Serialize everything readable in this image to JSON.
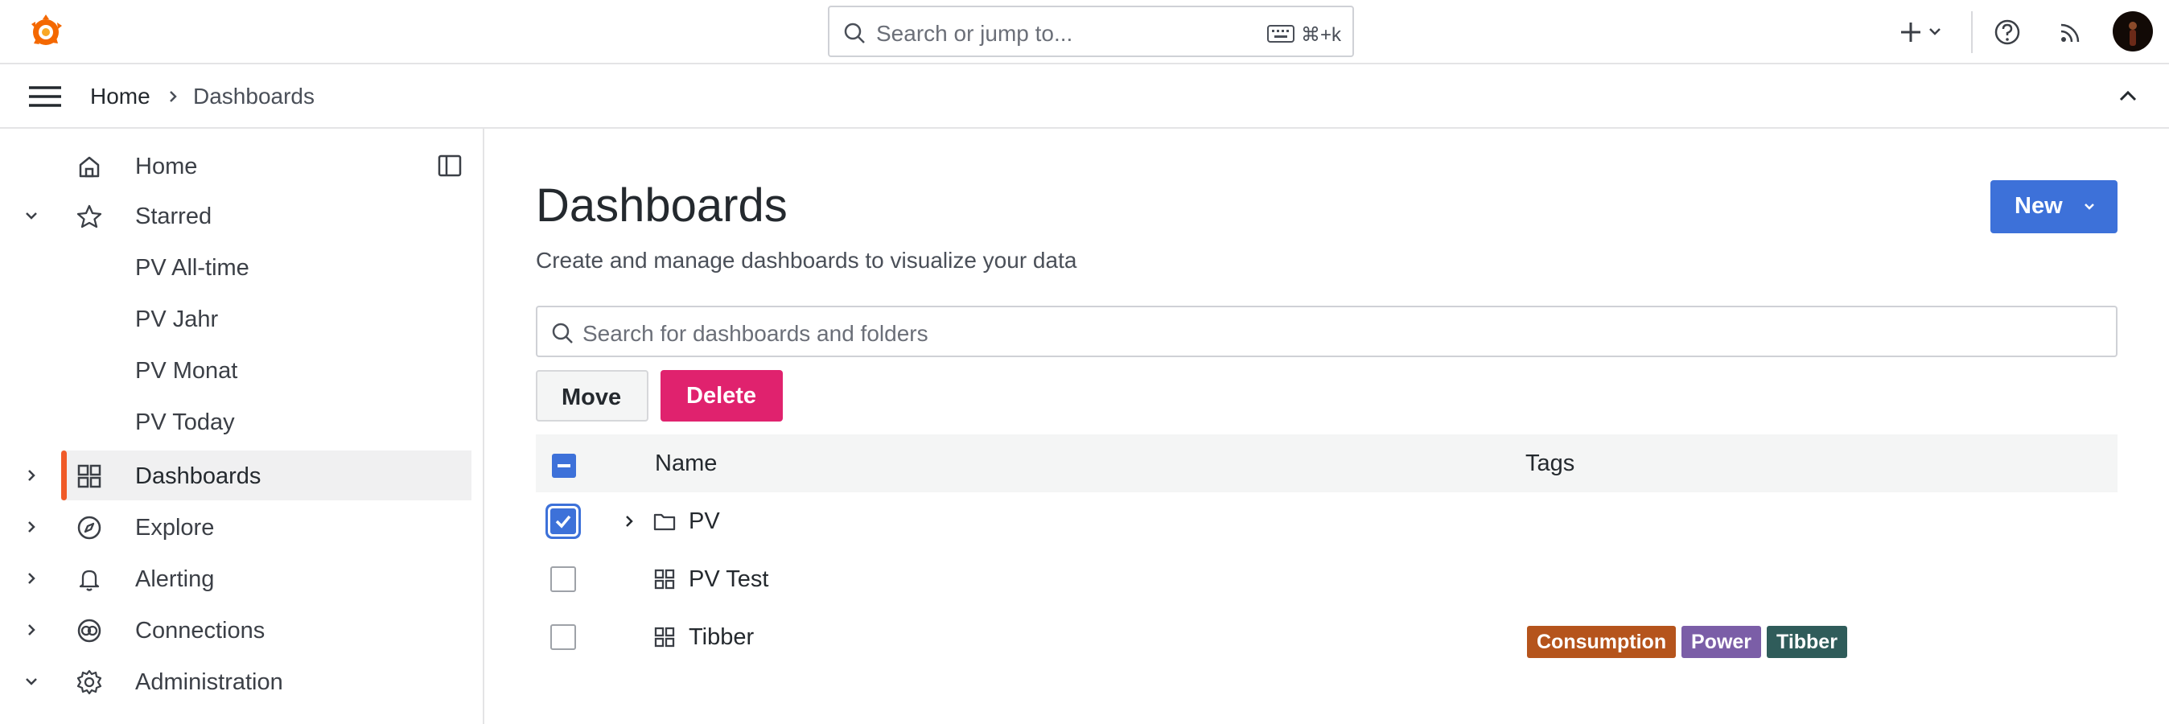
{
  "topbar": {
    "search_placeholder": "Search or jump to...",
    "search_shortcut": "⌘+k"
  },
  "breadcrumb": {
    "home": "Home",
    "current": "Dashboards"
  },
  "sidebar": {
    "items": [
      {
        "label": "Home",
        "icon": "home-icon"
      },
      {
        "label": "Starred",
        "icon": "star-icon"
      },
      {
        "label": "PV All-time"
      },
      {
        "label": "PV Jahr"
      },
      {
        "label": "PV Monat"
      },
      {
        "label": "PV Today"
      },
      {
        "label": "Dashboards",
        "icon": "grid-icon"
      },
      {
        "label": "Explore",
        "icon": "compass-icon"
      },
      {
        "label": "Alerting",
        "icon": "bell-icon"
      },
      {
        "label": "Connections",
        "icon": "connections-icon"
      },
      {
        "label": "Administration",
        "icon": "gear-icon"
      }
    ]
  },
  "main": {
    "title": "Dashboards",
    "subtitle": "Create and manage dashboards to visualize your data",
    "new_label": "New",
    "search_placeholder": "Search for dashboards and folders",
    "move_label": "Move",
    "delete_label": "Delete",
    "columns": {
      "name": "Name",
      "tags": "Tags"
    },
    "rows": [
      {
        "name": "PV",
        "type": "folder",
        "checked": true,
        "tags": []
      },
      {
        "name": "PV Test",
        "type": "dashboard",
        "checked": false,
        "tags": []
      },
      {
        "name": "Tibber",
        "type": "dashboard",
        "checked": false,
        "tags": [
          "Consumption",
          "Power",
          "Tibber"
        ]
      }
    ]
  },
  "colors": {
    "accent": "#3d71d9",
    "danger": "#e0226e",
    "active_bar": "#f05a28",
    "tag_consumption": "#b5541c",
    "tag_power": "#7b5ea7",
    "tag_tibber": "#2f5c5a"
  }
}
